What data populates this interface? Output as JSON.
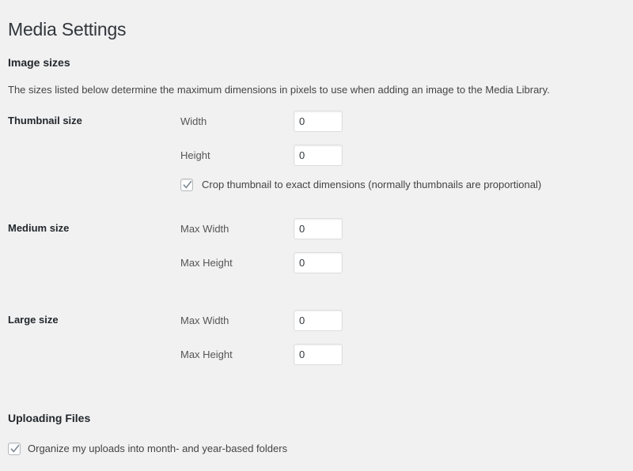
{
  "page": {
    "title": "Media Settings"
  },
  "image_sizes": {
    "heading": "Image sizes",
    "description": "The sizes listed below determine the maximum dimensions in pixels to use when adding an image to the Media Library.",
    "rows": [
      {
        "name": "Thumbnail size",
        "fields": [
          {
            "label": "Width",
            "value": "0"
          },
          {
            "label": "Height",
            "value": "0"
          }
        ]
      },
      {
        "name": "Medium size",
        "fields": [
          {
            "label": "Max Width",
            "value": "0"
          },
          {
            "label": "Max Height",
            "value": "0"
          }
        ]
      },
      {
        "name": "Large size",
        "fields": [
          {
            "label": "Max Width",
            "value": "0"
          },
          {
            "label": "Max Height",
            "value": "0"
          }
        ]
      }
    ],
    "crop_thumbnail": {
      "label": "Crop thumbnail to exact dimensions (normally thumbnails are proportional)",
      "checked": true,
      "icon": "checkmark-icon"
    }
  },
  "uploading_files": {
    "heading": "Uploading Files",
    "organize_uploads": {
      "label": "Organize my uploads into month- and year-based folders",
      "checked": true,
      "icon": "checkmark-icon"
    }
  },
  "colors": {
    "background": "#f1f1f1",
    "title_text": "#32373c",
    "body_text": "#444444",
    "label_text": "#23282d",
    "field_label_text": "#555555",
    "input_border": "#dddddd",
    "input_background": "#ffffff",
    "checkbox_border": "#b4b9be",
    "checkmark": "#7e8993"
  }
}
